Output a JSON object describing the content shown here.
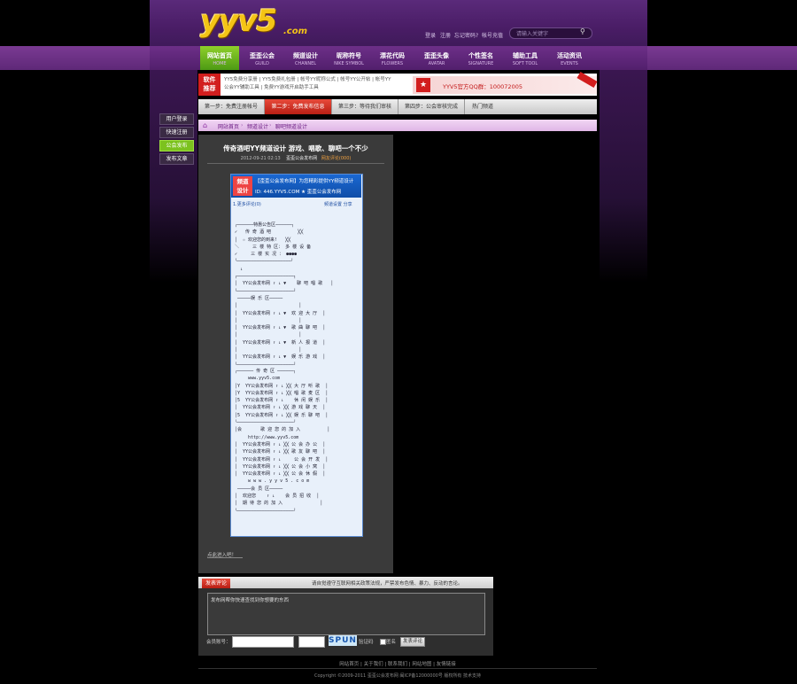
{
  "header": {
    "logo": "YYV5.COM",
    "logo_main": "yyv5",
    "logo_suffix": ".com",
    "top_links": [
      "登录",
      "注册",
      "忘记密码?",
      "帐号充值"
    ],
    "search_placeholder": "请输入关键字"
  },
  "nav": [
    {
      "label": "网站首页",
      "sub": "HOME"
    },
    {
      "label": "歪歪公会",
      "sub": "GUILD"
    },
    {
      "label": "频道设计",
      "sub": "CHANNEL"
    },
    {
      "label": "昵称符号",
      "sub": "NIKE SYMBOL"
    },
    {
      "label": "漂花代码",
      "sub": "FLOWERS"
    },
    {
      "label": "歪歪头像",
      "sub": "AVATAR"
    },
    {
      "label": "个性签名",
      "sub": "SIGNATURE"
    },
    {
      "label": "辅助工具",
      "sub": "SOFT TOOL"
    },
    {
      "label": "活动资讯",
      "sub": "EVENTS"
    }
  ],
  "side_buttons": [
    "用户登录",
    "快速注册",
    "公会发布",
    "发布文章"
  ],
  "promo": {
    "tag_line1": "软件",
    "tag_line2": "推荐",
    "line1": "YY5免费分享册 | YY5免费礼包册 | 帐号YY昵称公式 | 帐号YY公开帖 | 帐号YY",
    "line2": "公会YY辅助工具 | 免费YY游戏开启助手工具",
    "right_text": "YYV5官方QQ群：100072005"
  },
  "steps": [
    "第一步：免费注册帐号",
    "第二步：免费发布信息",
    "第三步：等待我们审核",
    "第四步：公会审核完成",
    "热门频道"
  ],
  "breadcrumb": [
    "网站首页",
    "频道设计",
    "聊吧频道设计"
  ],
  "article": {
    "title": "传奇酒吧YY频道设计 游戏、唱歌、聊吧一个不少",
    "date": "2012-09-21 02:13",
    "source": "歪歪公会发布网",
    "comments_label": "网友评论(000)",
    "image_header_line1": "【歪歪公会发布网】为您精彩提供YY频道设计",
    "image_header_line2": "ID: 446.YYV5.COM     ★ 歪歪公会发布网",
    "image_tag_line1": "频道",
    "image_tag_line2": "设计",
    "image_bar_left": "1.更多评论(0)",
    "image_bar_right": "频道设置 分享",
    "ascii_block1": " ╭──────特惠公告区──────╮\n ✓   传 奇 酒 吧          ╳╳\n │  ☆ 欢迎您的到来!   ╳╳\n ＼     三 楼 特 区： 多 楼 设 备\n ✓     三 楼 实 况 ： ●●●●\n ╰────────────────────╯\n   ↓\n ┌─────────────────────┐\n │  YY公会发布网 ↑ ↓ ▼    聊 吧 唱 歌   │\n └─────────────────────┘\n  ─────娱 乐 区─────\n │                       │\n │  YY公会发布网 ↑ ↓ ▼  欢 迎 大 厅  │\n │                       │\n │  YY公会发布网 ↑ ↓ ▼  歌 曲 聊 吧  │\n │                       │\n │  YY公会发布网 ↑ ↓ ▼  新 人 报 道  │\n │                       │\n │  YY公会发布网 ↑ ↓ ▼  娱 乐 游 戏  │\n └─────────────────────┘",
    "ascii_block2": " ╭────── 传 奇 区 ──────╮\n      www.yyv5.com\n │Y  YY公会发布网 ↑ ↓ ╳╳ 大 厅 听 歌  │\n │Y  YY公会发布网 ↑ ↓ ╳╳ 唱 歌 麦 区  │\n │5  YY公会发布网 ↑ ↓    休 闲 娱 乐  │\n │  YY公会发布网 ↑ ↓ ╳╳ 游 戏 聊 天  │\n │5  YY公会发布网 ↑ ↓ ╳╳ 娱 乐 聊 吧  │\n ╰─────────────────────╯\n │会       歌 迎 您 的 加 入          │\n      http://www.yyv5.com\n │  YY公会发布网 ↑ ↓ ╳╳ 公 会 办 公  │\n │  YY公会发布网 ↑ ↓ ╳╳ 歌 友 聊 吧  │\n │  YY公会发布网 ↑ ↓     公 会 开 发  │\n │  YY公会发布网 ↑ ↓ ╳╳ 公 会 小 窝  │\n │  YY公会发布网 ↑ ↓ ╳╳ 公 会 休 假  │\n      w w w . y y v 5 . c o m\n  ─────会 员 区─────\n │  欢迎您    ↑ ↓    会 员 招 收  │\n │  期 待 您 的 加 入              │\n ╰─────────────────────╯",
    "footer_note": "点此进入吧！"
  },
  "comment": {
    "tab": "发表评论",
    "note": "请自觉遵守互联网相关政策法规，严禁发布色情、暴力、反动的言论。",
    "placeholder": "发布网帮你快速查找到你想要的东西",
    "user_label": "会员账号：",
    "captcha": "SPUN",
    "refresh": "验证码",
    "anon": "匿名",
    "submit": "发表评论"
  },
  "footer": {
    "links": "网站首页 | 关于我们 | 联系我们 | 网站地图 | 友情链接",
    "copyright": "Copyright ©2009-2011 歪歪公会发布网 闽ICP备12000000号 版权所有 技术支持"
  }
}
